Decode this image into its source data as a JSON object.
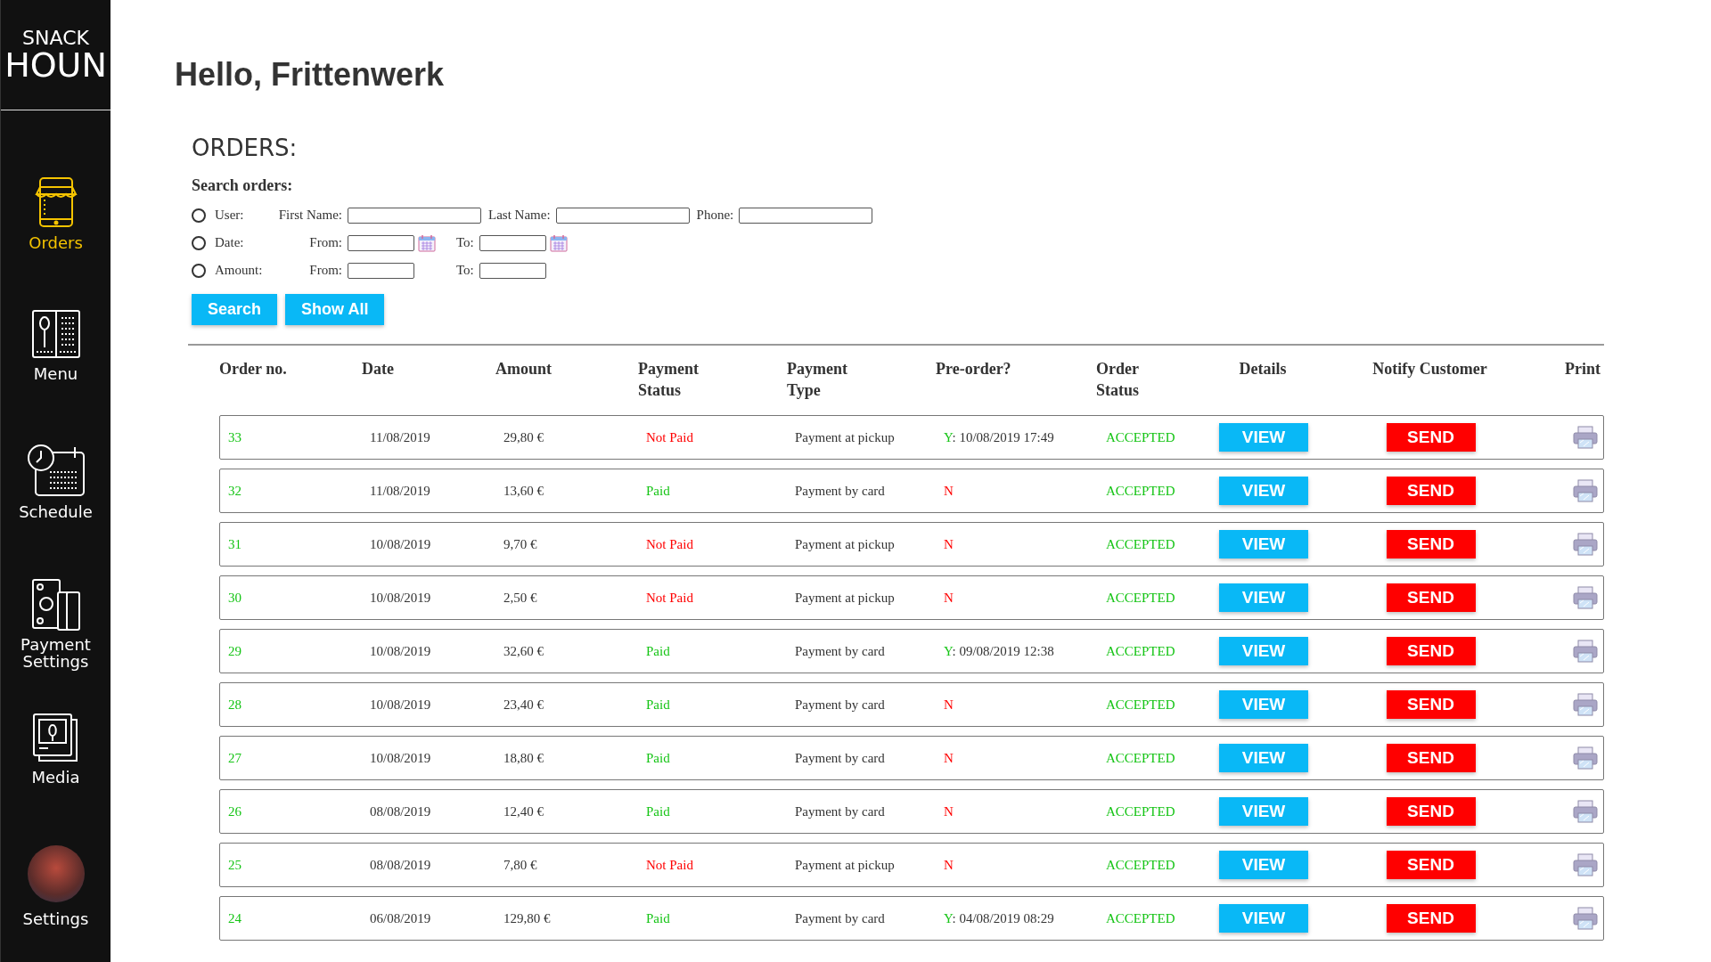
{
  "sidebar": {
    "logo": {
      "line1": "SNACK",
      "line2": "HOUN"
    },
    "items": [
      {
        "label": "Orders",
        "kind": "orders",
        "selected": true
      },
      {
        "label": "Menu",
        "kind": "menu",
        "selected": false
      },
      {
        "label": "Schedule",
        "kind": "schedule",
        "selected": false
      },
      {
        "label": "Payment Settings",
        "kind": "payment",
        "selected": false
      },
      {
        "label": "Media",
        "kind": "media",
        "selected": false
      },
      {
        "label": "Settings",
        "kind": "avatar",
        "selected": false
      }
    ]
  },
  "greeting": "Hello, Frittenwerk",
  "orders_title": "ORDERS:",
  "search": {
    "heading": "Search orders:",
    "rows": [
      {
        "kind": "text",
        "label": "User:",
        "selected": false,
        "fields": [
          {
            "label": "First Name:",
            "kind": "text"
          },
          {
            "label": "Last Name:",
            "kind": "text"
          },
          {
            "label": "Phone:",
            "kind": "text"
          }
        ]
      },
      {
        "kind": "range",
        "label": "Date:",
        "selected": false,
        "fields": [
          {
            "label": "From:",
            "kind": "date"
          },
          {
            "label": "To:",
            "kind": "date"
          }
        ]
      },
      {
        "kind": "range",
        "label": "Amount:",
        "selected": false,
        "fields": [
          {
            "label": "From:",
            "kind": "text"
          },
          {
            "label": "To:",
            "kind": "text"
          }
        ]
      }
    ],
    "buttons": [
      "Search",
      "Show All"
    ]
  },
  "table": {
    "columns": [
      "Order no.",
      "Date",
      "Amount",
      "Payment Status",
      "Payment Type",
      "Pre-order?",
      "Order Status",
      "Details",
      "Notify Customer",
      "Print"
    ],
    "rows": [
      {
        "order_no": "33",
        "date": "11/08/2019",
        "amount": "29,80 €",
        "payment_status": {
          "text": "Not Paid",
          "paid": false
        },
        "payment_type": "Payment at pickup",
        "pre_order": {
          "flag": "Y",
          "time": ": 10/08/2019 17:49",
          "preordered": true
        },
        "order_status": "ACCEPTED",
        "details": "VIEW",
        "notify": "SEND"
      },
      {
        "order_no": "32",
        "date": "11/08/2019",
        "amount": "13,60 €",
        "payment_status": {
          "text": "Paid",
          "paid": true
        },
        "payment_type": "Payment by card",
        "pre_order": {
          "flag": "N",
          "preordered": false
        },
        "order_status": "ACCEPTED",
        "details": "VIEW",
        "notify": "SEND"
      },
      {
        "order_no": "31",
        "date": "10/08/2019",
        "amount": "9,70 €",
        "payment_status": {
          "text": "Not Paid",
          "paid": false
        },
        "payment_type": "Payment at pickup",
        "pre_order": {
          "flag": "N",
          "preordered": false
        },
        "order_status": "ACCEPTED",
        "details": "VIEW",
        "notify": "SEND"
      },
      {
        "order_no": "30",
        "date": "10/08/2019",
        "amount": "2,50 €",
        "payment_status": {
          "text": "Not Paid",
          "paid": false
        },
        "payment_type": "Payment at pickup",
        "pre_order": {
          "flag": "N",
          "preordered": false
        },
        "order_status": "ACCEPTED",
        "details": "VIEW",
        "notify": "SEND"
      },
      {
        "order_no": "29",
        "date": "10/08/2019",
        "amount": "32,60 €",
        "payment_status": {
          "text": "Paid",
          "paid": true
        },
        "payment_type": "Payment by card",
        "pre_order": {
          "flag": "Y",
          "time": ": 09/08/2019 12:38",
          "preordered": true
        },
        "order_status": "ACCEPTED",
        "details": "VIEW",
        "notify": "SEND"
      },
      {
        "order_no": "28",
        "date": "10/08/2019",
        "amount": "23,40 €",
        "payment_status": {
          "text": "Paid",
          "paid": true
        },
        "payment_type": "Payment by card",
        "pre_order": {
          "flag": "N",
          "preordered": false
        },
        "order_status": "ACCEPTED",
        "details": "VIEW",
        "notify": "SEND"
      },
      {
        "order_no": "27",
        "date": "10/08/2019",
        "amount": "18,80 €",
        "payment_status": {
          "text": "Paid",
          "paid": true
        },
        "payment_type": "Payment by card",
        "pre_order": {
          "flag": "N",
          "preordered": false
        },
        "order_status": "ACCEPTED",
        "details": "VIEW",
        "notify": "SEND"
      },
      {
        "order_no": "26",
        "date": "08/08/2019",
        "amount": "12,40 €",
        "payment_status": {
          "text": "Paid",
          "paid": true
        },
        "payment_type": "Payment by card",
        "pre_order": {
          "flag": "N",
          "preordered": false
        },
        "order_status": "ACCEPTED",
        "details": "VIEW",
        "notify": "SEND"
      },
      {
        "order_no": "25",
        "date": "08/08/2019",
        "amount": "7,80 €",
        "payment_status": {
          "text": "Not Paid",
          "paid": false
        },
        "payment_type": "Payment at pickup",
        "pre_order": {
          "flag": "N",
          "preordered": false
        },
        "order_status": "ACCEPTED",
        "details": "VIEW",
        "notify": "SEND"
      },
      {
        "order_no": "24",
        "date": "06/08/2019",
        "amount": "129,80 €",
        "payment_status": {
          "text": "Paid",
          "paid": true
        },
        "payment_type": "Payment by card",
        "pre_order": {
          "flag": "Y",
          "time": ": 04/08/2019 08:29",
          "preordered": true
        },
        "order_status": "ACCEPTED",
        "details": "VIEW",
        "notify": "SEND"
      }
    ]
  }
}
